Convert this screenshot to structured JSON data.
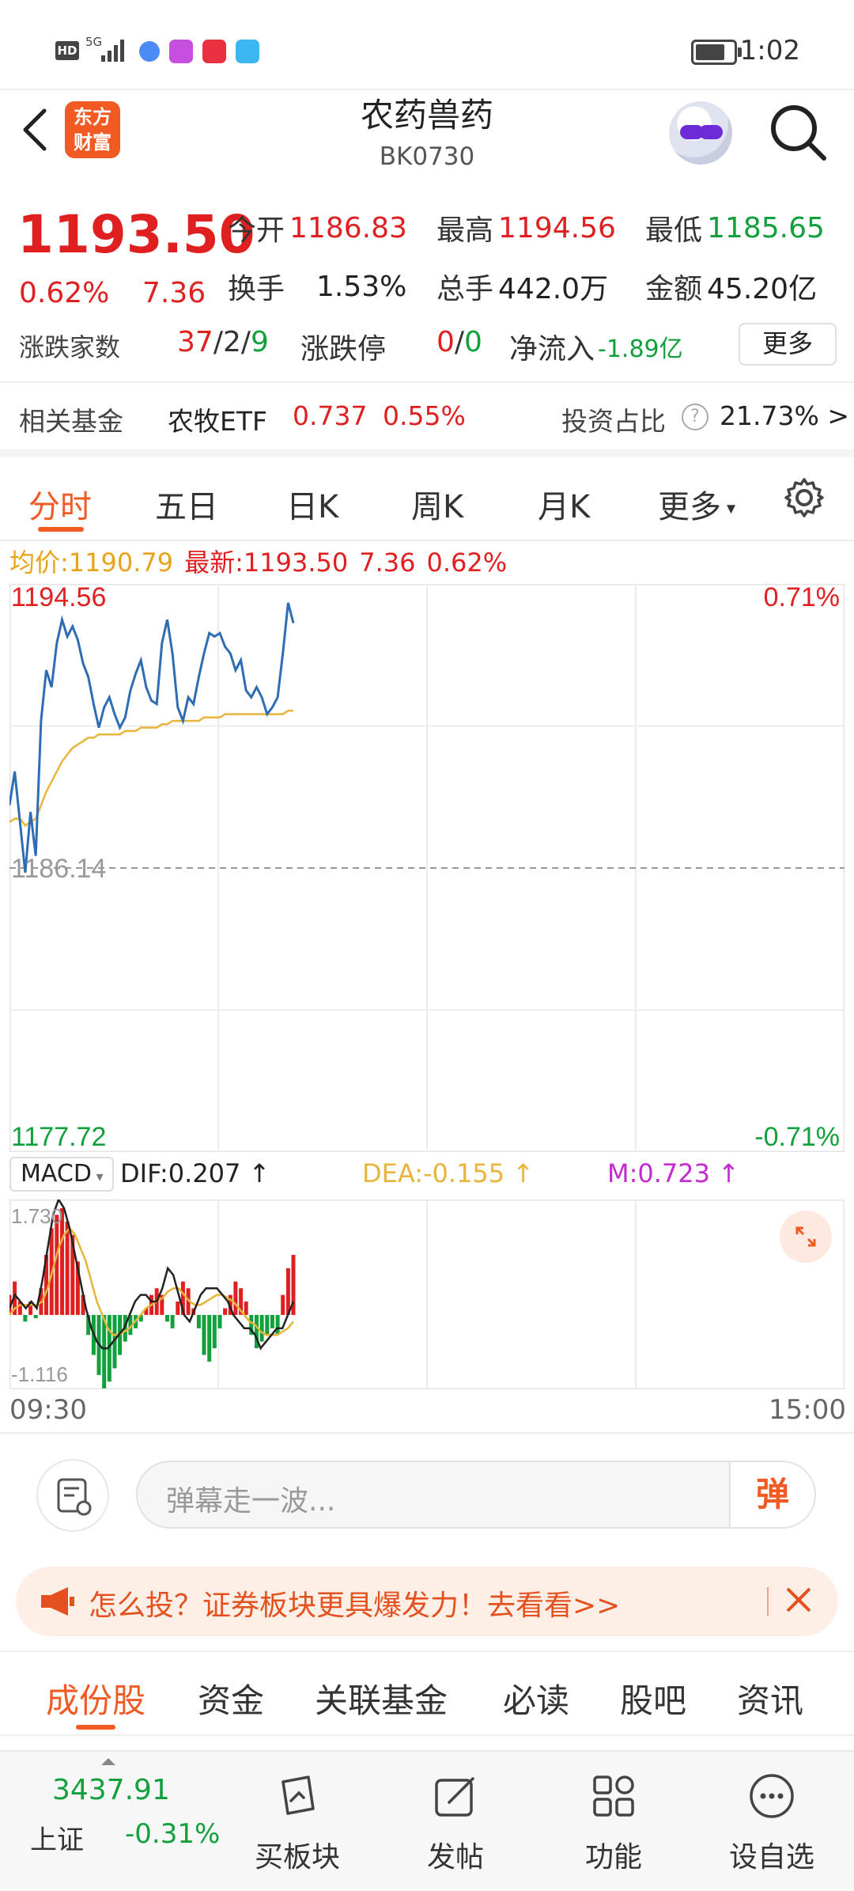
{
  "status_bar": {
    "time": "1:02",
    "network": "5G",
    "hd": "HD"
  },
  "header": {
    "logo_line1": "东方",
    "logo_line2": "财富",
    "title": "农药兽药",
    "code": "BK0730"
  },
  "quote": {
    "price": "1193.50",
    "change_pct": "0.62%",
    "change": "7.36",
    "open_label": "今开",
    "open": "1186.83",
    "high_label": "最高",
    "high": "1194.56",
    "low_label": "最低",
    "low": "1185.65",
    "turnover_label": "换手",
    "turnover": "1.53%",
    "volume_label": "总手",
    "volume": "442.0万",
    "amount_label": "金额",
    "amount": "45.20亿",
    "updown_label": "涨跌家数",
    "up_count": "37",
    "flat_count": "2",
    "down_count": "9",
    "slash": "/",
    "limit_label": "涨跌停",
    "limit_up": "0",
    "limit_down": "0",
    "inflow_label": "净流入",
    "inflow": "-1.89亿",
    "more_label": "更多"
  },
  "fund": {
    "label": "相关基金",
    "name": "农牧ETF",
    "price": "0.737",
    "pct": "0.55%",
    "ratio_label": "投资占比",
    "ratio": "21.73% >"
  },
  "chart_tabs": [
    "分时",
    "五日",
    "日K",
    "周K",
    "月K",
    "更多"
  ],
  "avg": {
    "avg_label": "均价:",
    "avg_value": "1190.79",
    "latest_label": "最新:",
    "latest_value": "1193.50",
    "latest_change": "7.36",
    "latest_pct": "0.62%"
  },
  "chart_data": [
    {
      "type": "line",
      "title": "",
      "y_axis_left": {
        "top": "1194.56",
        "mid": "1186.14",
        "bottom": "1177.72"
      },
      "y_axis_right": {
        "top": "0.71%",
        "bottom": "-0.71%"
      },
      "ylim": [
        1177.72,
        1194.56
      ],
      "baseline": 1186.14,
      "x_labels": [
        "09:30",
        "15:00"
      ],
      "colors": {
        "price": "#2e6db4",
        "avg": "#e8b43a",
        "up": "#e02020",
        "down": "#12a03c"
      },
      "series": [
        {
          "values": [
            1188.0,
            1189.0,
            1187.5,
            1186.0,
            1187.8,
            1186.5,
            1190.5,
            1192.0,
            1191.5,
            1192.8,
            1193.5,
            1193.0,
            1193.3,
            1192.9,
            1192.2,
            1191.8,
            1191.0,
            1190.3,
            1190.9,
            1191.2,
            1190.7,
            1190.3,
            1190.6,
            1191.4,
            1191.9,
            1192.3,
            1191.5,
            1191.1,
            1191.0,
            1192.8,
            1193.5,
            1192.5,
            1190.9,
            1190.5,
            1191.2,
            1191.0,
            1191.8,
            1192.5,
            1193.1,
            1193.0,
            1193.1,
            1192.7,
            1192.5,
            1192.0,
            1192.3,
            1191.4,
            1191.2,
            1191.5,
            1191.2,
            1190.7,
            1190.9,
            1191.2,
            1192.5,
            1194.0,
            1193.4
          ],
          "note": ""
        },
        {
          "values": [
            1187.5,
            1187.6,
            1187.6,
            1187.4,
            1187.5,
            1187.6,
            1188.0,
            1188.4,
            1188.7,
            1189.0,
            1189.3,
            1189.5,
            1189.7,
            1189.8,
            1189.9,
            1190.0,
            1190.0,
            1190.1,
            1190.1,
            1190.1,
            1190.1,
            1190.1,
            1190.2,
            1190.2,
            1190.2,
            1190.3,
            1190.3,
            1190.3,
            1190.3,
            1190.4,
            1190.4,
            1190.5,
            1190.5,
            1190.5,
            1190.5,
            1190.5,
            1190.5,
            1190.6,
            1190.6,
            1190.6,
            1190.6,
            1190.7,
            1190.7,
            1190.7,
            1190.7,
            1190.7,
            1190.7,
            1190.7,
            1190.7,
            1190.7,
            1190.7,
            1190.7,
            1190.7,
            1190.8,
            1190.8
          ]
        }
      ]
    },
    {
      "type": "bar",
      "title": "",
      "indicator": "MACD",
      "dif_label": "DIF:0.207",
      "dea_label": "DEA:-0.155",
      "m_label": "M:0.723",
      "y_top": "1.730",
      "y_bottom": "-1.116",
      "ylim": [
        -1.116,
        1.73
      ],
      "hist": [
        0.3,
        0.5,
        0.2,
        -0.1,
        0.2,
        -0.05,
        0.4,
        0.9,
        1.3,
        1.5,
        1.6,
        1.4,
        1.2,
        0.8,
        0.3,
        -0.3,
        -0.6,
        -0.9,
        -1.1,
        -1.0,
        -0.8,
        -0.6,
        -0.4,
        -0.3,
        -0.2,
        -0.1,
        0.1,
        0.3,
        0.4,
        0.3,
        -0.1,
        -0.2,
        0.2,
        0.5,
        0.4,
        0.1,
        -0.2,
        -0.6,
        -0.7,
        -0.5,
        -0.2,
        0.1,
        0.3,
        0.5,
        0.4,
        0.2,
        -0.3,
        -0.5,
        -0.4,
        -0.3,
        -0.2,
        -0.3,
        0.3,
        0.7,
        0.9
      ],
      "dif": [
        0.1,
        0.3,
        0.2,
        0.1,
        0.2,
        0.1,
        0.5,
        1.0,
        1.5,
        1.73,
        1.6,
        1.3,
        0.9,
        0.5,
        0.1,
        -0.2,
        -0.4,
        -0.5,
        -0.5,
        -0.4,
        -0.3,
        -0.2,
        0.0,
        0.2,
        0.3,
        0.3,
        0.2,
        0.2,
        0.4,
        0.7,
        0.6,
        0.3,
        0.0,
        -0.1,
        0.1,
        0.3,
        0.4,
        0.4,
        0.4,
        0.3,
        0.2,
        0.0,
        -0.1,
        -0.2,
        -0.2,
        -0.3,
        -0.5,
        -0.4,
        -0.3,
        -0.2,
        -0.2,
        0.0,
        0.2
      ],
      "dea": [
        0.0,
        0.1,
        0.15,
        0.15,
        0.15,
        0.15,
        0.2,
        0.4,
        0.7,
        1.0,
        1.2,
        1.3,
        1.2,
        1.0,
        0.8,
        0.5,
        0.2,
        0.0,
        -0.2,
        -0.3,
        -0.3,
        -0.25,
        -0.2,
        -0.1,
        0.0,
        0.1,
        0.15,
        0.2,
        0.25,
        0.35,
        0.4,
        0.4,
        0.3,
        0.2,
        0.15,
        0.15,
        0.2,
        0.25,
        0.3,
        0.3,
        0.25,
        0.2,
        0.1,
        0.0,
        -0.1,
        -0.15,
        -0.25,
        -0.3,
        -0.3,
        -0.3,
        -0.25,
        -0.2,
        -0.1
      ]
    }
  ],
  "comment": {
    "placeholder": "弹幕走一波...",
    "danmu_btn": "弹"
  },
  "promo": {
    "text": "怎么投？证券板块更具爆发力！去看看>>"
  },
  "bottom_tabs": [
    "成份股",
    "资金",
    "关联基金",
    "必读",
    "股吧",
    "资讯"
  ],
  "navbar": {
    "index_value": "3437.91",
    "index_name": "上证",
    "index_pct": "-0.31%",
    "items": [
      "买板块",
      "发帖",
      "功能",
      "设自选"
    ]
  }
}
